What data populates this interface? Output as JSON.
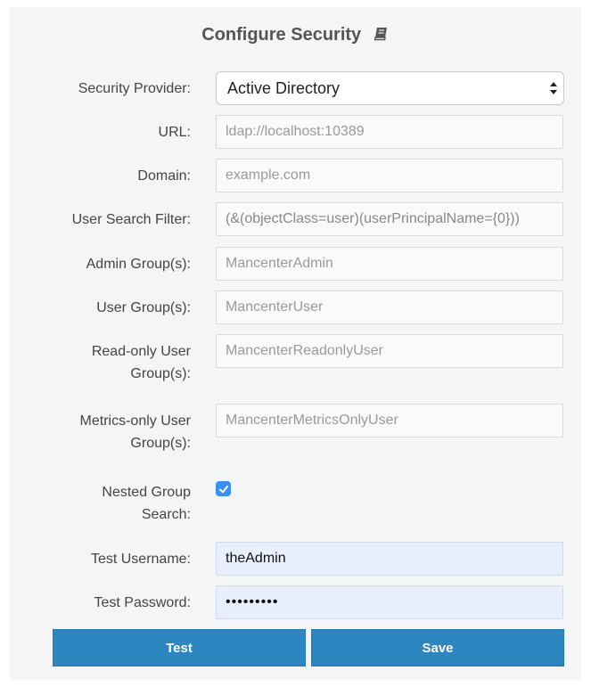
{
  "title": "Configure Security",
  "title_icon": "book-icon",
  "form": {
    "security_provider": {
      "label": "Security Provider:",
      "value": "Active Directory"
    },
    "url": {
      "label": "URL:",
      "placeholder": "ldap://localhost:10389"
    },
    "domain": {
      "label": "Domain:",
      "placeholder": "example.com"
    },
    "user_search_filter": {
      "label": "User Search Filter:",
      "placeholder": "(&(objectClass=user)(userPrincipalName={0}))"
    },
    "admin_groups": {
      "label": "Admin Group(s):",
      "placeholder": "MancenterAdmin"
    },
    "user_groups": {
      "label": "User Group(s):",
      "placeholder": "MancenterUser"
    },
    "readonly_groups": {
      "label_line1": "Read-only User",
      "label_line2": "Group(s):",
      "placeholder": "MancenterReadonlyUser"
    },
    "metrics_groups": {
      "label_line1": "Metrics-only User",
      "label_line2": "Group(s):",
      "placeholder": "MancenterMetricsOnlyUser"
    },
    "nested_group_search": {
      "label_line1": "Nested Group",
      "label_line2": "Search:",
      "checked": true
    },
    "test_username": {
      "label": "Test Username:",
      "value": "theAdmin"
    },
    "test_password": {
      "label": "Test Password:",
      "value": "•••••••••"
    }
  },
  "buttons": {
    "test": "Test",
    "save": "Save"
  },
  "colors": {
    "button": "#2d86c0",
    "checkbox": "#3a8ff0",
    "autofill": "#e8f0fe"
  }
}
